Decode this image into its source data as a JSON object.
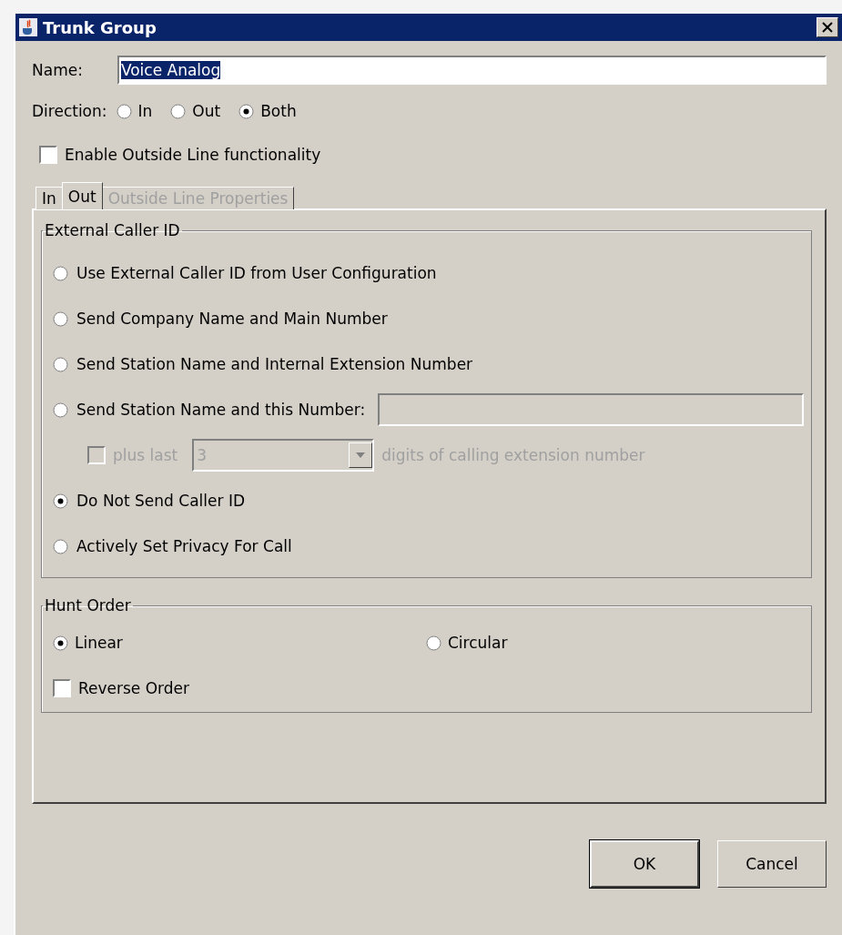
{
  "window": {
    "title": "Trunk Group"
  },
  "name": {
    "label": "Name:",
    "value": "Voice Analog"
  },
  "direction": {
    "label": "Direction:",
    "options": [
      {
        "label": "In",
        "selected": false
      },
      {
        "label": "Out",
        "selected": false
      },
      {
        "label": "Both",
        "selected": true
      }
    ]
  },
  "enable_outside_line": {
    "label": "Enable Outside Line functionality",
    "checked": false
  },
  "tabs": [
    {
      "label": "In",
      "selected": false,
      "disabled": false
    },
    {
      "label": "Out",
      "selected": true,
      "disabled": false
    },
    {
      "label": "Outside Line Properties",
      "selected": false,
      "disabled": true
    }
  ],
  "external_caller_id": {
    "title": "External Caller ID",
    "options": [
      {
        "kind": "radio",
        "label": "Use External Caller ID from User Configuration",
        "selected": false
      },
      {
        "kind": "radio",
        "label": "Send Company Name and Main Number",
        "selected": false
      },
      {
        "kind": "radio",
        "label": "Send Station Name and Internal Extension Number",
        "selected": false
      },
      {
        "kind": "radio_field",
        "label": "Send Station Name and this Number:",
        "selected": false
      },
      {
        "kind": "digits",
        "label": "plus last",
        "checked": false,
        "disabled": true,
        "value": "3",
        "suffix": "digits of calling extension number"
      },
      {
        "kind": "radio",
        "label": "Do Not Send Caller ID",
        "selected": true
      },
      {
        "kind": "radio",
        "label": "Actively Set Privacy For Call",
        "selected": false
      }
    ]
  },
  "hunt_order": {
    "title": "Hunt Order",
    "options": [
      {
        "label": "Linear",
        "selected": true
      },
      {
        "label": "Circular",
        "selected": false
      }
    ],
    "reverse": {
      "label": "Reverse Order",
      "checked": false
    }
  },
  "buttons": [
    {
      "label": "OK",
      "default": true
    },
    {
      "label": "Cancel",
      "default": false
    }
  ]
}
